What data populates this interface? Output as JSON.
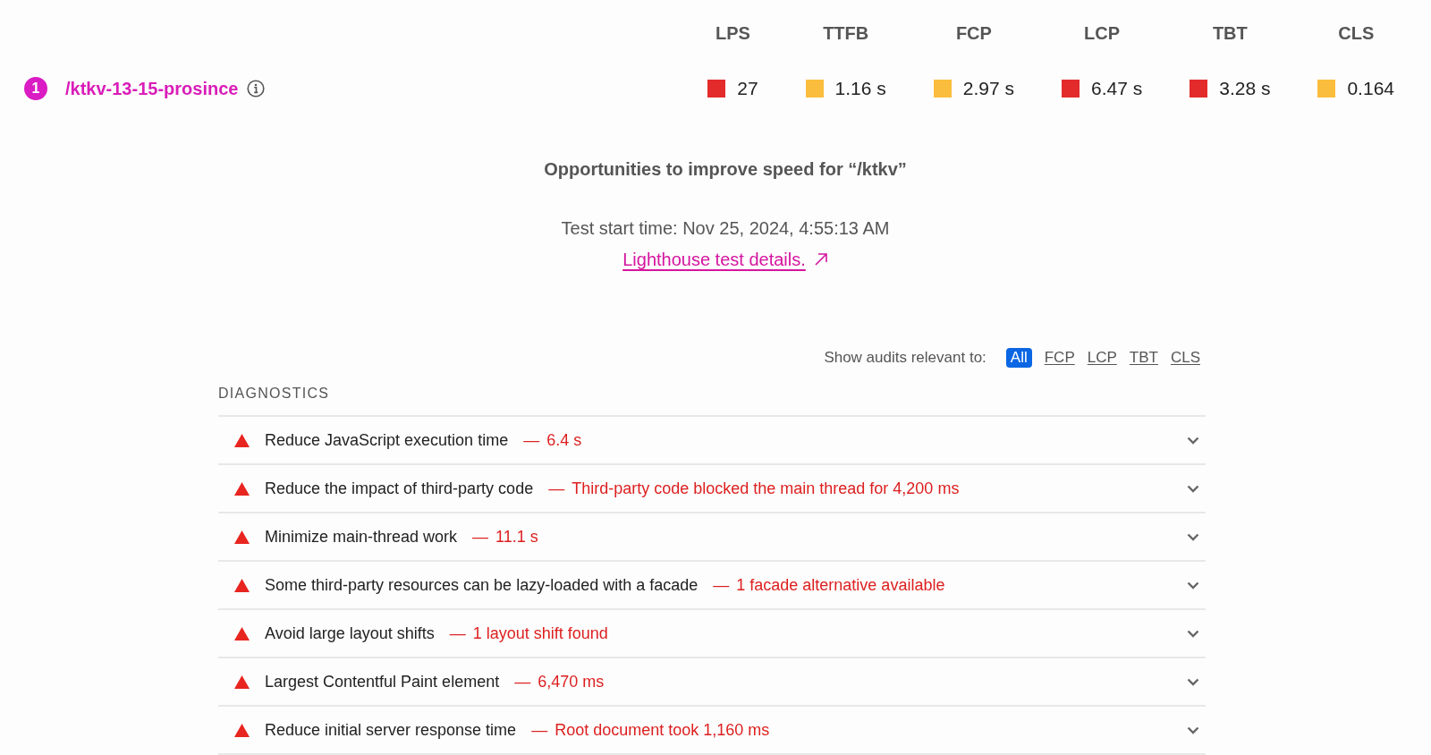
{
  "metrics": [
    {
      "label": "LPS",
      "value": "27",
      "color": "#e32b2b"
    },
    {
      "label": "TTFB",
      "value": "1.16 s",
      "color": "#fbbd3d"
    },
    {
      "label": "FCP",
      "value": "2.97 s",
      "color": "#fbbd3d"
    },
    {
      "label": "LCP",
      "value": "6.47 s",
      "color": "#e32b2b"
    },
    {
      "label": "TBT",
      "value": "3.28 s",
      "color": "#e32b2b"
    },
    {
      "label": "CLS",
      "value": "0.164",
      "color": "#fbbd3d"
    }
  ],
  "page_row": {
    "rank": "1",
    "path": "/ktkv-13-15-prosince"
  },
  "report": {
    "title": "Opportunities to improve speed for “/ktkv”",
    "test_start": "Test start time: Nov 25, 2024, 4:55:13 AM",
    "details_link": "Lighthouse test details."
  },
  "filters": {
    "label": "Show audits relevant to:",
    "options": [
      {
        "label": "All",
        "selected": true
      },
      {
        "label": "FCP",
        "selected": false
      },
      {
        "label": "LCP",
        "selected": false
      },
      {
        "label": "TBT",
        "selected": false
      },
      {
        "label": "CLS",
        "selected": false
      }
    ]
  },
  "diagnostics": {
    "heading": "DIAGNOSTICS",
    "items": [
      {
        "title": "Reduce JavaScript execution time",
        "separator": "—",
        "detail": "6.4 s",
        "expanded": false
      },
      {
        "title": "Reduce the impact of third-party code",
        "separator": "—",
        "detail": "Third-party code blocked the main thread for 4,200 ms",
        "expanded": false
      },
      {
        "title": "Minimize main-thread work",
        "separator": "—",
        "detail": "11.1 s",
        "expanded": false
      },
      {
        "title": "Some third-party resources can be lazy-loaded with a facade",
        "separator": "—",
        "detail": "1 facade alternative available",
        "expanded": false
      },
      {
        "title": "Avoid large layout shifts",
        "separator": "—",
        "detail": "1 layout shift found",
        "expanded": false
      },
      {
        "title": "Largest Contentful Paint element",
        "separator": "—",
        "detail": "6,470 ms",
        "expanded": false
      },
      {
        "title": "Reduce initial server response time",
        "separator": "—",
        "detail": "Root document took 1,160 ms",
        "expanded": false
      }
    ]
  }
}
